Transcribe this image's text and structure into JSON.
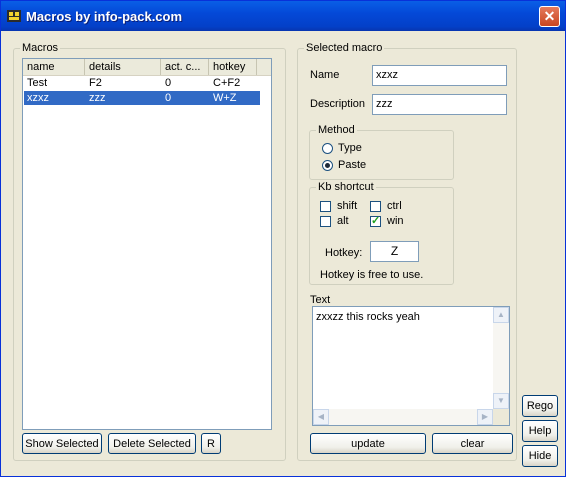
{
  "window": {
    "title": "Macros by info-pack.com",
    "close_glyph": "✕"
  },
  "macros_group": {
    "label": "Macros",
    "columns": [
      "name",
      "details",
      "act. c...",
      "hotkey"
    ],
    "rows": [
      {
        "name": "Test",
        "details": "F2",
        "act": "0",
        "hotkey": "C+F2",
        "selected": false
      },
      {
        "name": "xzxz",
        "details": "zzz",
        "act": "0",
        "hotkey": "W+Z",
        "selected": true
      }
    ],
    "show_selected_label": "Show Selected",
    "delete_selected_label": "Delete Selected",
    "r_label": "R"
  },
  "selected_macro": {
    "label": "Selected macro",
    "name_label": "Name",
    "name_value": "xzxz",
    "description_label": "Description",
    "description_value": "zzz",
    "method": {
      "label": "Method",
      "type_label": "Type",
      "paste_label": "Paste",
      "selected": "Paste"
    },
    "kb_shortcut": {
      "label": "Kb shortcut",
      "shift_label": "shift",
      "shift": false,
      "ctrl_label": "ctrl",
      "ctrl": false,
      "alt_label": "alt",
      "alt": false,
      "win_label": "win",
      "win": true,
      "hotkey_label": "Hotkey:",
      "hotkey_value": "Z",
      "status": "Hotkey is free to use."
    },
    "text_label": "Text",
    "text_value": "zxxzz this rocks yeah",
    "update_label": "update",
    "clear_label": "clear"
  },
  "side_buttons": {
    "rego": "Rego",
    "help": "Help",
    "hide": "Hide"
  }
}
